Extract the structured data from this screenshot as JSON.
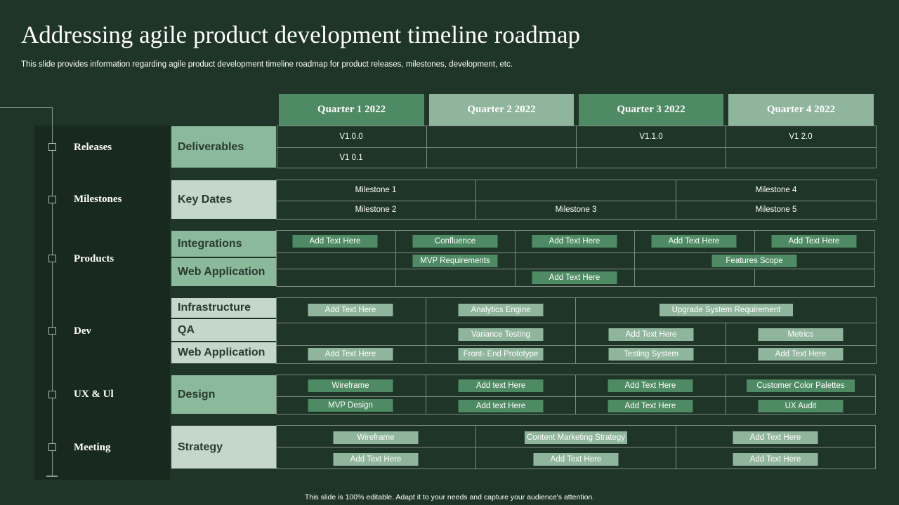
{
  "title": "Addressing agile product development timeline roadmap",
  "subtitle": "This slide provides information regarding agile product development timeline roadmap for product releases, milestones, development, etc.",
  "footer": "This slide is 100% editable.  Adapt it to your needs and capture your audience's attention.",
  "rail": [
    "Releases",
    "Milestones",
    "Products",
    "Dev",
    "UX & Ul",
    "Meeting"
  ],
  "quarters": [
    "Quarter 1 2022",
    "Quarter 2 2022",
    "Quarter 3 2022",
    "Quarter 4 2022"
  ],
  "categories": {
    "deliverables": "Deliverables",
    "key_dates": "Key Dates",
    "integrations": "Integrations",
    "web_app1": "Web Application",
    "infrastructure": "Infrastructure",
    "qa": "QA",
    "web_app2": "Web Application",
    "design": "Design",
    "strategy": "Strategy"
  },
  "deliverables": [
    "V1.0.0",
    "V1 0.1",
    "V1.1.0",
    "V1 2.0"
  ],
  "milestones": [
    "Milestone 1",
    "Milestone 2",
    "Milestone 3",
    "Milestone 4",
    "Milestone 5"
  ],
  "products": {
    "integrations": [
      "Add Text Here",
      "Confluence",
      "Add Text Here",
      "Add Text Here",
      "Add Text Here"
    ],
    "web_app_row1": [
      "MVP  Requirements",
      "Features Scope"
    ],
    "web_app_row2": [
      "Add Text Here"
    ]
  },
  "dev": {
    "infrastructure": [
      "Add Text Here",
      "Analytics Engine",
      "Upgrade System Requirement"
    ],
    "qa": [
      "Variance Testing",
      "Add Text Here",
      "Metrics"
    ],
    "web_app": [
      "Add Text Here",
      "Front- End Prototype",
      "Testing System",
      "Add Text Here"
    ]
  },
  "design": {
    "row1": [
      "Wireframe",
      "Add text Here",
      "Add Text Here",
      "Customer Color Palettes"
    ],
    "row2": [
      "MVP  Design",
      "Add text Here",
      "Add Text Here",
      "UX Audit"
    ]
  },
  "strategy": {
    "row1": [
      "Wireframe",
      "Content Marketing Strategy",
      "Add Text Here"
    ],
    "row2": [
      "Add Text Here",
      "Add Text Here",
      "Add Text Here"
    ]
  },
  "colors": {
    "background": "#1f3527",
    "accent_dark": "#4e8a63",
    "accent_light": "#8fb59c"
  }
}
